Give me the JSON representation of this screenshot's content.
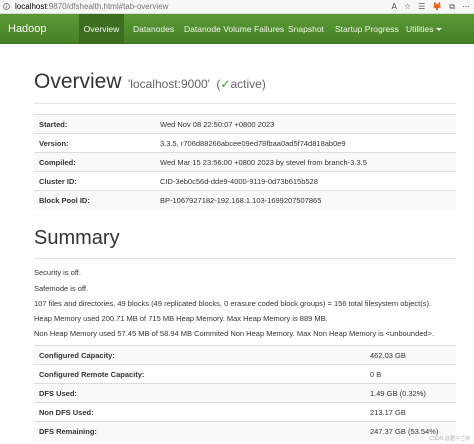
{
  "browser": {
    "url_host": "localhost",
    "url_rest": ":9870/dfshealth.html#tab-overview",
    "toolbar_icons": [
      "A",
      "☆",
      "☰",
      "🦊",
      "⧉",
      "⋯"
    ]
  },
  "navbar": {
    "brand": "Hadoop",
    "items": [
      {
        "label": "Overview",
        "active": true
      },
      {
        "label": "Datanodes",
        "active": false
      },
      {
        "label": "Datanode Volume Failures",
        "active": false
      },
      {
        "label": "Snapshot",
        "active": false
      },
      {
        "label": "Startup Progress",
        "active": false
      },
      {
        "label": "Utilities",
        "active": false
      }
    ],
    "bg_color": "#4f8b2e"
  },
  "overview": {
    "title": "Overview",
    "host": "'localhost:9000'",
    "status_prefix": "(",
    "status_check": "✓",
    "status_text": "active)",
    "rows": [
      {
        "key": "Started:",
        "value": "Wed Nov 08 22:50:07 +0800 2023"
      },
      {
        "key": "Version:",
        "value": "3.3.5, r706d88266abcee09ed78fbaa0ad5f74d818ab0e9"
      },
      {
        "key": "Compiled:",
        "value": "Wed Mar 15 23:56:00 +0800 2023 by stevel from branch-3.3.5"
      },
      {
        "key": "Cluster ID:",
        "value": "CID-3eb0c56d-dde9-4000-9119-0d73b615b528"
      },
      {
        "key": "Block Pool ID:",
        "value": "BP-1067927182-192.168.1.103-1699207507865"
      }
    ]
  },
  "summary": {
    "title": "Summary",
    "lines": [
      "Security is off.",
      "Safemode is off.",
      "107 files and directories, 49 blocks (49 replicated blocks, 0 erasure coded block groups) = 156 total filesystem object(s).",
      "Heap Memory used 200.71 MB of 715 MB Heap Memory. Max Heap Memory is 889 MB.",
      "Non Heap Memory used 57.45 MB of 58.94 MB Commited Non Heap Memory. Max Non Heap Memory is <unbounded>."
    ],
    "rows": [
      {
        "key": "Configured Capacity:",
        "value": "462.03 GB"
      },
      {
        "key": "Configured Remote Capacity:",
        "value": "0 B"
      },
      {
        "key": "DFS Used:",
        "value": "1.49 GB (0.32%)"
      },
      {
        "key": "Non DFS Used:",
        "value": "213.17 GB"
      },
      {
        "key": "DFS Remaining:",
        "value": "247.37 GB (53.54%)"
      }
    ]
  },
  "watermark": "CSDN @君子兰雨"
}
